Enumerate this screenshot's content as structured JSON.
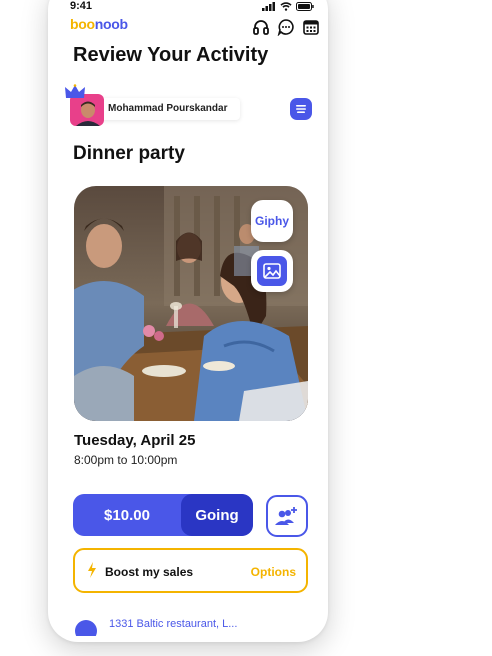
{
  "status_bar": {
    "time": "9:41"
  },
  "app": {
    "logo_part1": "boo",
    "logo_part2": "noob"
  },
  "page": {
    "title": "Review Your Activity"
  },
  "user": {
    "name": "Mohammad Pourskandar"
  },
  "event": {
    "title": "Dinner party",
    "date": "Tuesday, April 25",
    "time_range": "8:00pm to 10:00pm",
    "media_buttons": {
      "giphy_label": "Giphy"
    }
  },
  "actions": {
    "price": "$10.00",
    "going_label": "Going",
    "boost_label": "Boost my sales",
    "options_label": "Options"
  },
  "address": {
    "text": "1331 Baltic restaurant, L..."
  },
  "colors": {
    "accent": "#4a57e8",
    "accent_dark": "#2a36c4",
    "boost": "#f4b400"
  },
  "icons": {
    "headset": "headphones-icon",
    "chat": "chat-bubble-icon",
    "calendar": "calendar-icon",
    "menu": "menu-icon",
    "image": "image-icon",
    "add_people": "add-people-icon",
    "bolt": "lightning-icon",
    "crown": "crown-icon"
  }
}
